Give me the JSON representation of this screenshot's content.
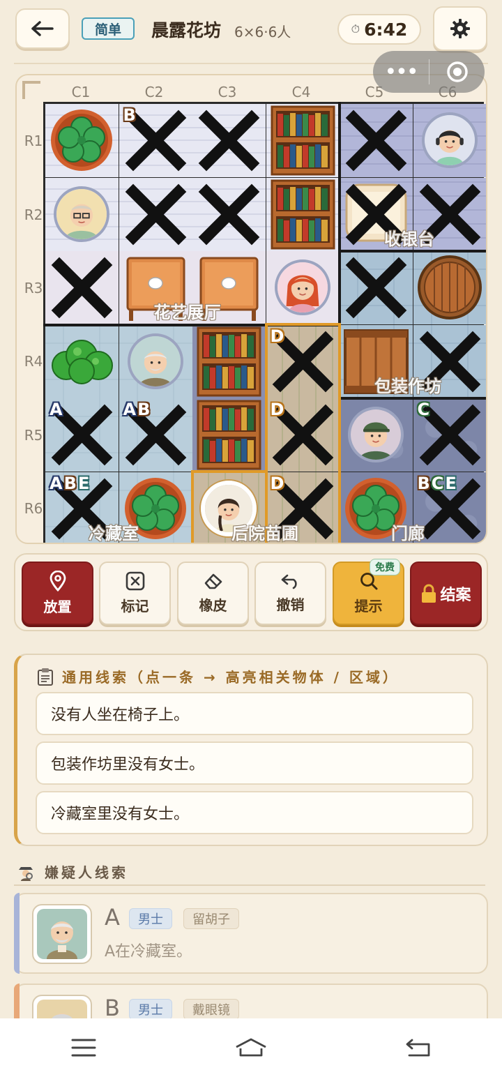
{
  "header": {
    "difficulty": "简单",
    "title": "晨露花坊",
    "subtitle": "6×6·6人",
    "timer_icon": "⏱",
    "timer": "6:42"
  },
  "board": {
    "col_labels": [
      "C1",
      "C2",
      "C3",
      "C4",
      "C5",
      "C6"
    ],
    "row_labels": [
      "R1",
      "R2",
      "R3",
      "R4",
      "R5",
      "R6"
    ],
    "rooms": [
      "收银台",
      "花艺展厅",
      "包装作坊",
      "冷藏室",
      "后院苗圃",
      "门廊"
    ],
    "cells": [
      {
        "r": 1,
        "c": 1,
        "bg": "lav",
        "obj": "planter"
      },
      {
        "r": 1,
        "c": 2,
        "bg": "lav",
        "x": true,
        "letters": [
          "B"
        ]
      },
      {
        "r": 1,
        "c": 3,
        "bg": "lav",
        "x": true
      },
      {
        "r": 1,
        "c": 4,
        "bg": "lav",
        "obj": "bookshelf"
      },
      {
        "r": 1,
        "c": 5,
        "bg": "peri",
        "x": true
      },
      {
        "r": 1,
        "c": 6,
        "bg": "peri",
        "obj": "avatar-woman-headphones"
      },
      {
        "r": 2,
        "c": 1,
        "bg": "lav",
        "obj": "avatar-man-glasses"
      },
      {
        "r": 2,
        "c": 2,
        "bg": "lav",
        "x": true
      },
      {
        "r": 2,
        "c": 3,
        "bg": "lav",
        "x": true
      },
      {
        "r": 2,
        "c": 4,
        "bg": "lav",
        "obj": "bookshelf"
      },
      {
        "r": 2,
        "c": 5,
        "bg": "peri",
        "obj": "chair",
        "x": true
      },
      {
        "r": 2,
        "c": 6,
        "bg": "peri",
        "x": true
      },
      {
        "r": 3,
        "c": 1,
        "bg": "hall",
        "x": true
      },
      {
        "r": 3,
        "c": 2,
        "bg": "hall",
        "obj": "table"
      },
      {
        "r": 3,
        "c": 3,
        "bg": "hall",
        "obj": "table"
      },
      {
        "r": 3,
        "c": 4,
        "bg": "hall",
        "obj": "avatar-woman-redhair"
      },
      {
        "r": 3,
        "c": 5,
        "bg": "pack",
        "x": true
      },
      {
        "r": 3,
        "c": 6,
        "bg": "pack",
        "obj": "barrel"
      },
      {
        "r": 4,
        "c": 1,
        "bg": "ice",
        "obj": "bush"
      },
      {
        "r": 4,
        "c": 2,
        "bg": "ice",
        "obj": "avatar-old-man"
      },
      {
        "r": 4,
        "c": 3,
        "bg": "shelfbg",
        "obj": "bookshelf"
      },
      {
        "r": 4,
        "c": 4,
        "bg": "garden",
        "x": true,
        "letters": [
          "D"
        ]
      },
      {
        "r": 4,
        "c": 5,
        "bg": "pack",
        "obj": "crate"
      },
      {
        "r": 4,
        "c": 6,
        "bg": "pack",
        "x": true
      },
      {
        "r": 5,
        "c": 1,
        "bg": "ice",
        "x": true,
        "letters": [
          "A"
        ]
      },
      {
        "r": 5,
        "c": 2,
        "bg": "ice",
        "x": true,
        "letters": [
          "A",
          "B"
        ]
      },
      {
        "r": 5,
        "c": 3,
        "bg": "shelfbg",
        "obj": "bookshelf"
      },
      {
        "r": 5,
        "c": 4,
        "bg": "garden",
        "x": true,
        "letters": [
          "D"
        ]
      },
      {
        "r": 5,
        "c": 5,
        "bg": "entry",
        "obj": "avatar-man-cap"
      },
      {
        "r": 5,
        "c": 6,
        "bg": "entry",
        "x": true,
        "letters": [
          "C"
        ]
      },
      {
        "r": 6,
        "c": 1,
        "bg": "ice",
        "x": true,
        "letters": [
          "A",
          "B",
          "E"
        ]
      },
      {
        "r": 6,
        "c": 2,
        "bg": "ice",
        "obj": "planter"
      },
      {
        "r": 6,
        "c": 3,
        "bg": "garden",
        "obj": "avatar-woman-braid"
      },
      {
        "r": 6,
        "c": 4,
        "bg": "garden",
        "x": true,
        "letters": [
          "D"
        ]
      },
      {
        "r": 6,
        "c": 5,
        "bg": "entry",
        "obj": "planter"
      },
      {
        "r": 6,
        "c": 6,
        "bg": "entry",
        "x": true,
        "letters": [
          "B",
          "C",
          "E"
        ]
      }
    ]
  },
  "toolbar": {
    "place": "放置",
    "mark": "标记",
    "eraser": "橡皮",
    "undo": "撤销",
    "hint": "提示",
    "hint_badge": "免费",
    "close_case": "结案"
  },
  "clues": {
    "heading": "通用线索（点一条 → 高亮相关物体 / 区域）",
    "items": [
      "没有人坐在椅子上。",
      "包装作坊里没有女士。",
      "冷藏室里没有女士。"
    ]
  },
  "suspects": {
    "heading": "嫌疑人线索",
    "items": [
      {
        "name": "A",
        "gender": "男士",
        "trait": "留胡子",
        "clue": "A在冷藏室。",
        "color": "#a8b4d8"
      },
      {
        "name": "B",
        "gender": "男士",
        "trait": "戴眼镜",
        "clue": "",
        "color": "#e8a878"
      }
    ]
  }
}
